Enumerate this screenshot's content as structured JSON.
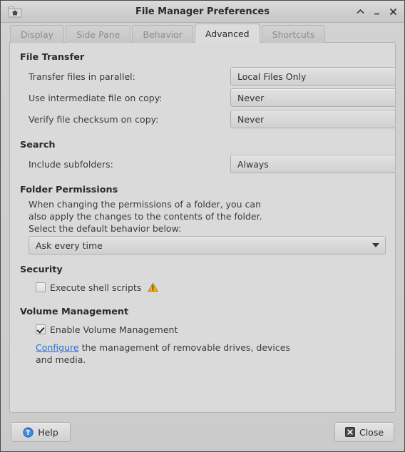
{
  "window": {
    "title": "File Manager Preferences",
    "icon": "home-folder-icon",
    "controls": {
      "shade_label": "⌃",
      "minimize_label": "_",
      "close_label": "✕"
    }
  },
  "tabs": [
    {
      "label": "Display",
      "active": false
    },
    {
      "label": "Side Pane",
      "active": false
    },
    {
      "label": "Behavior",
      "active": false
    },
    {
      "label": "Advanced",
      "active": true
    },
    {
      "label": "Shortcuts",
      "active": false
    }
  ],
  "sections": {
    "file_transfer": {
      "title": "File Transfer",
      "rows": [
        {
          "label": "Transfer files in parallel:",
          "value": "Local Files Only"
        },
        {
          "label": "Use intermediate file on copy:",
          "value": "Never"
        },
        {
          "label": "Verify file checksum on copy:",
          "value": "Never"
        }
      ]
    },
    "search": {
      "title": "Search",
      "rows": [
        {
          "label": "Include subfolders:",
          "value": "Always"
        }
      ]
    },
    "folder_permissions": {
      "title": "Folder Permissions",
      "description": "When changing the permissions of a folder, you can also apply the changes to the contents of the folder. Select the default behavior below:",
      "value": "Ask every time"
    },
    "security": {
      "title": "Security",
      "checkbox_label": "Execute shell scripts",
      "checked": false,
      "warning_icon": "warning-triangle-icon"
    },
    "volume_management": {
      "title": "Volume Management",
      "checkbox_label": "Enable Volume Management",
      "checked": true,
      "link_label": "Configure",
      "link_suffix": " the management of removable drives, devices and media."
    }
  },
  "actions": {
    "help_label": "Help",
    "close_label": "Close"
  },
  "colors": {
    "link": "#2a6fd4",
    "warning": "#f0b429",
    "window_bg": "#cfcfcf",
    "panel_bg": "#dadada"
  }
}
